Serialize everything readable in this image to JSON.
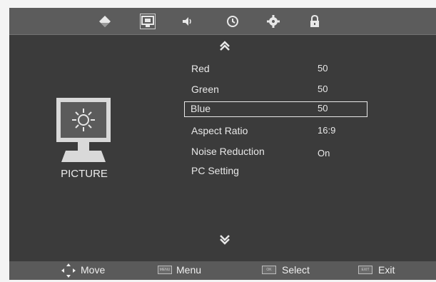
{
  "top_menu": {
    "icons": [
      "tv-source-icon",
      "picture-icon",
      "sound-icon",
      "time-icon",
      "setup-icon",
      "lock-icon"
    ],
    "active": "picture-icon"
  },
  "category": {
    "label": "PICTURE",
    "icon": "monitor-brightness-icon"
  },
  "menu": {
    "items": [
      {
        "label": "Red",
        "value": "50"
      },
      {
        "label": "Green",
        "value": "50"
      },
      {
        "label": "Blue",
        "value": "50"
      },
      {
        "label": "Aspect Ratio",
        "value": "16:9"
      },
      {
        "label": "Noise Reduction",
        "value": "On"
      },
      {
        "label": "PC Setting",
        "value": ""
      }
    ],
    "selected_label": "Blue"
  },
  "bottom_bar": {
    "move": "Move",
    "menu": "Menu",
    "menu_key": "MENU",
    "select": "Select",
    "select_key": "OK",
    "exit": "Exit",
    "exit_key": "EXIT"
  },
  "colors": {
    "panel": "#3b3b3b",
    "top_bar": "#5c5c5c",
    "bottom_bar": "#5a5a5a",
    "text": "#e8e8e8"
  }
}
